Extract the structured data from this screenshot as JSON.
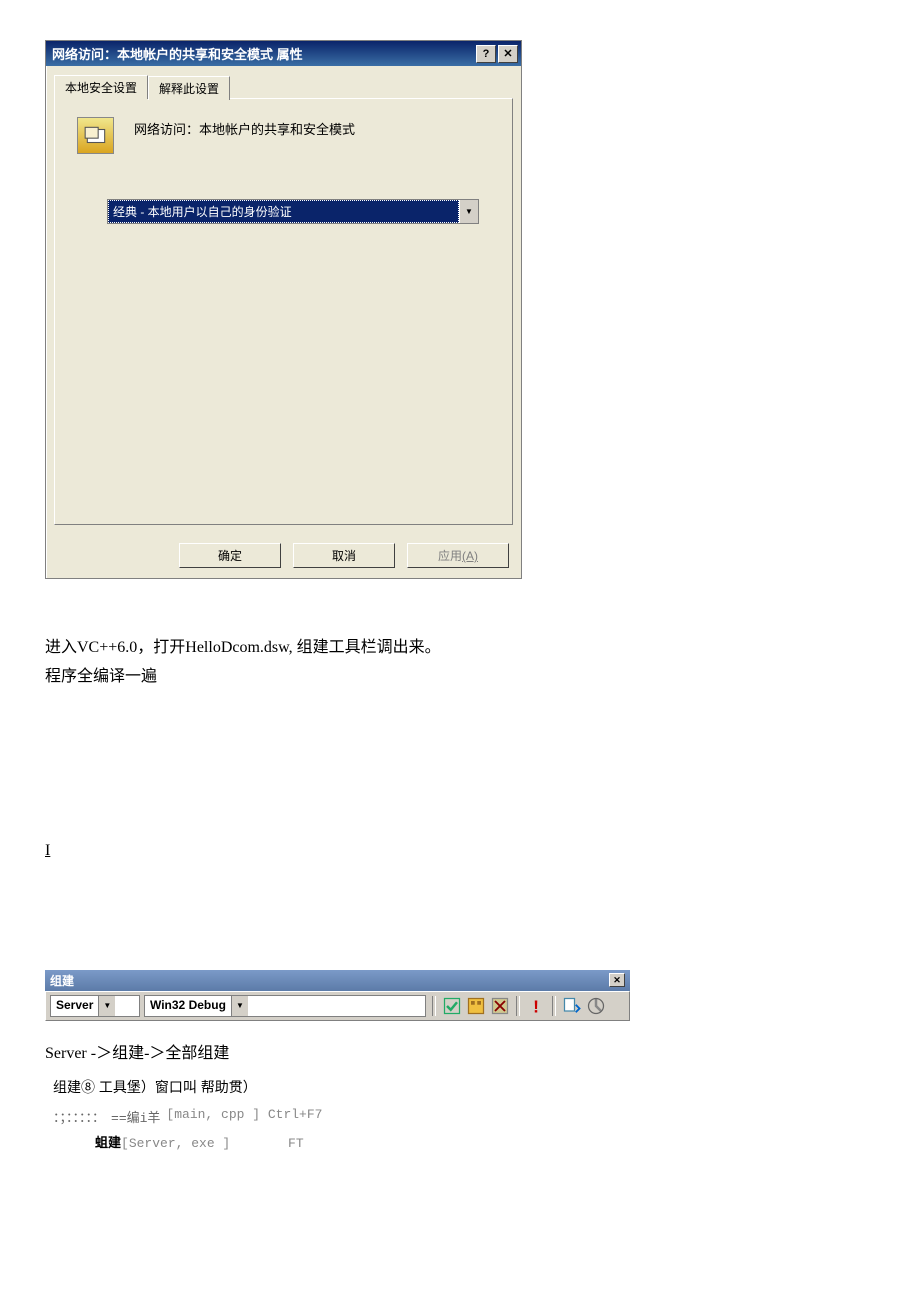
{
  "dialog": {
    "title": "网络访问：本地帐户的共享和安全模式 属性",
    "tabs": {
      "active": "本地安全设置",
      "inactive": "解释此设置"
    },
    "policy_label": "网络访问：本地帐户的共享和安全模式",
    "combo_value": "经典 - 本地用户以自己的身份验证",
    "buttons": {
      "ok": "确定",
      "cancel": "取消",
      "apply_text": "应用",
      "apply_mn": "(A)"
    }
  },
  "body": {
    "line1": "进入VC++6.0，打开HelloDcom.dsw, 组建工具栏调出来。",
    "line2": "程序全编译一遍",
    "stray": "I"
  },
  "toolbar": {
    "title": "组建",
    "combo1": "Server",
    "combo2": "Win32 Debug"
  },
  "bottom": {
    "nav": "Server -＞组建-＞全部组建",
    "menu": "组建⑧  工具堡）窗口叫  帮助贯）",
    "line_prefix": "：；：：：：：",
    "compile": "==编i羊",
    "compile_file": "[main, cpp ] Ctrl+F7",
    "build": "蛆建",
    "build_file": "[Server, exe ]",
    "build_key": "FT"
  }
}
